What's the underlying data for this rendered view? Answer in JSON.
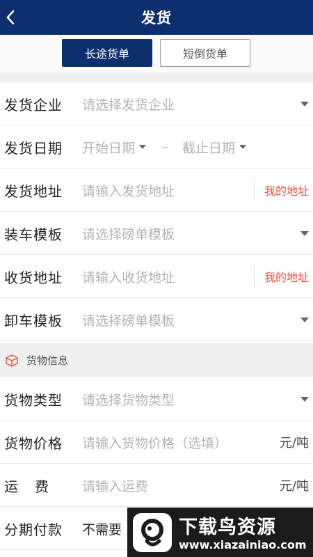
{
  "header": {
    "title": "发货"
  },
  "tabs": [
    {
      "label": "长途货单",
      "active": true
    },
    {
      "label": "短倒货单",
      "active": false
    }
  ],
  "form": {
    "company": {
      "label": "发货企业",
      "placeholder": "请选择发货企业"
    },
    "date": {
      "label": "发货日期",
      "start": "开始日期",
      "separator": "–",
      "end": "截止日期"
    },
    "ship_address": {
      "label": "发货地址",
      "placeholder": "请输入发货地址",
      "link": "我的地址"
    },
    "load_template": {
      "label": "装车模板",
      "placeholder": "请选择磅单模板"
    },
    "receive_address": {
      "label": "收货地址",
      "placeholder": "请输入收货地址",
      "link": "我的地址"
    },
    "unload_template": {
      "label": "卸车模板",
      "placeholder": "请选择磅单模板"
    }
  },
  "cargo_section": {
    "title": "货物信息"
  },
  "cargo": {
    "type": {
      "label": "货物类型",
      "placeholder": "请选择货物类型"
    },
    "price": {
      "label": "货物价格",
      "placeholder": "请输入货物价格（选填）",
      "unit": "元/吨"
    },
    "freight": {
      "label": "运　费",
      "placeholder": "请输入运费",
      "unit": "元/吨"
    },
    "installment": {
      "label": "分期付款",
      "value": "不需要"
    }
  },
  "watermark": {
    "title": "下载鸟资源",
    "url": "www.xiazainiao.com"
  },
  "colors": {
    "header_bg": "#0d2f6e",
    "link": "#e5513f",
    "section_bg": "#f0f0f0"
  }
}
